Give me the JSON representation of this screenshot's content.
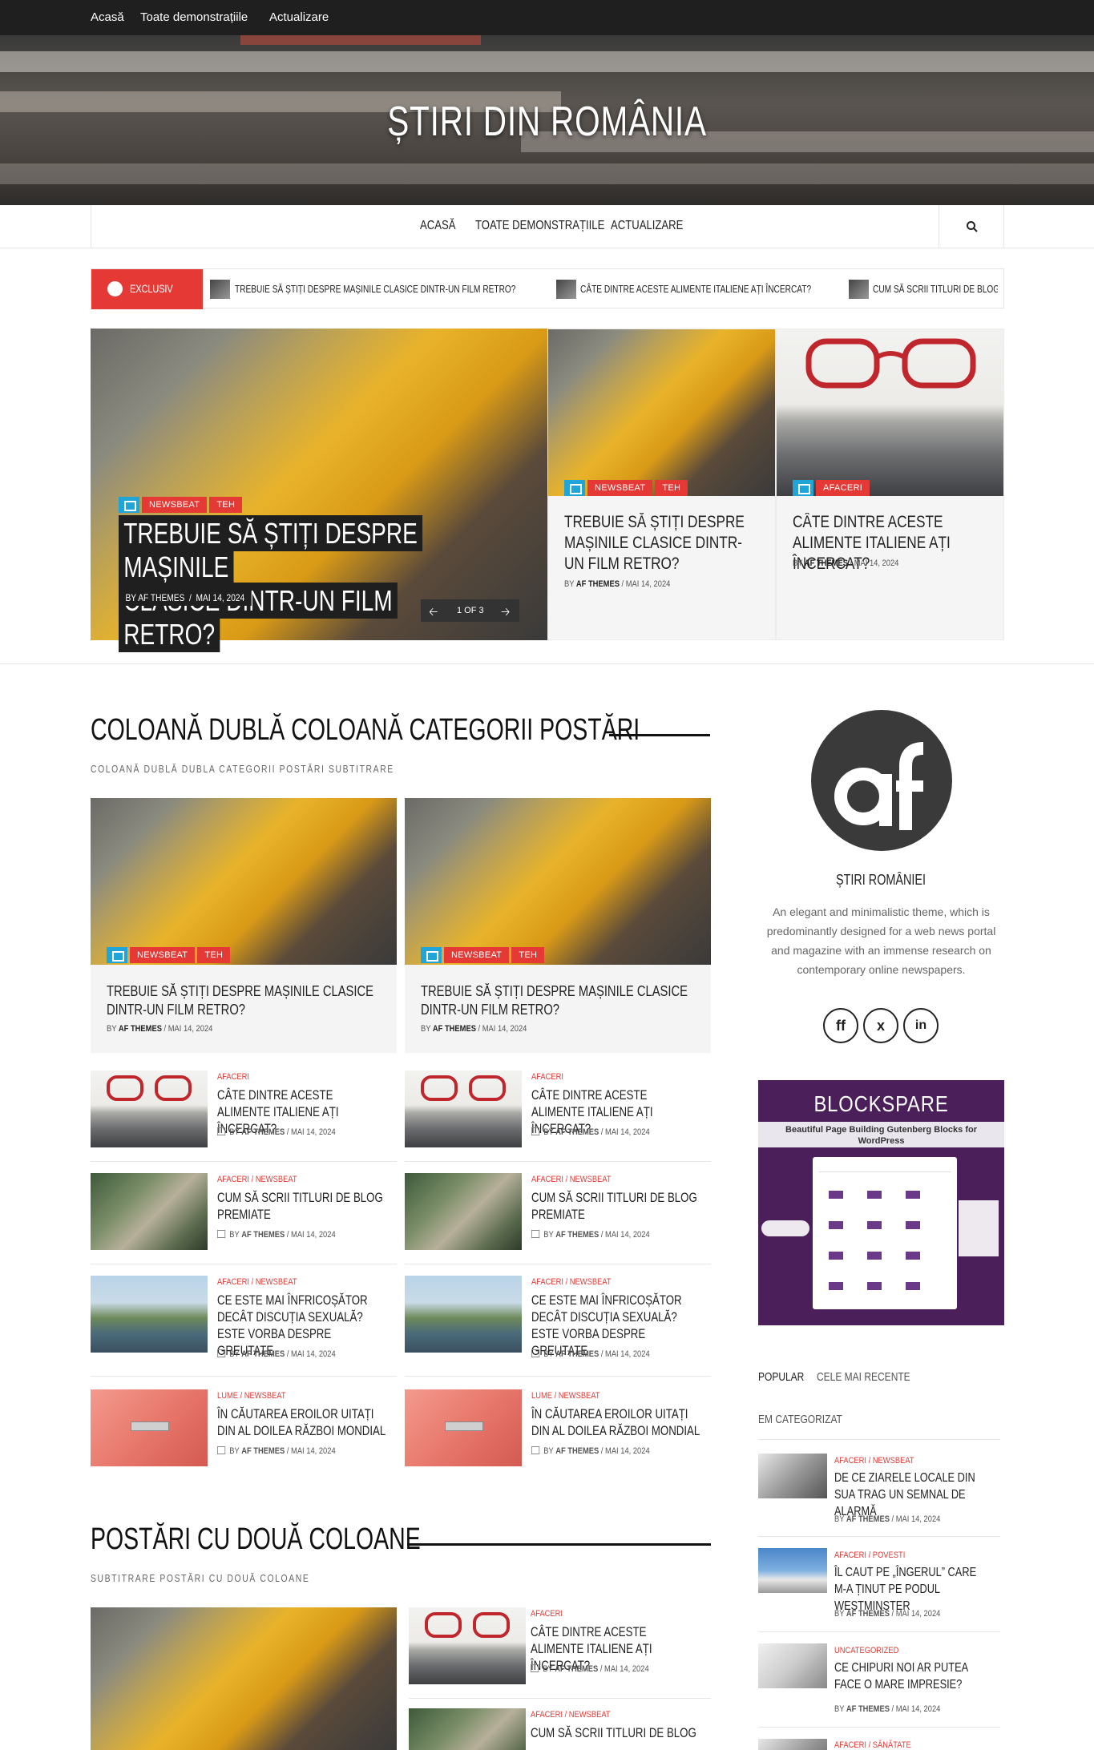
{
  "topbar": {
    "links": [
      "Acasă",
      "Toate demonstrațiile",
      "Actualizare"
    ]
  },
  "site": {
    "title": "ȘTIRI DIN ROMÂNIA"
  },
  "nav": {
    "items": [
      "ACASĂ",
      "TOATE DEMONSTRAȚIILE",
      "ACTUALIZARE"
    ],
    "search_icon": "search-icon"
  },
  "ticker": {
    "label": "EXCLUSIV",
    "items": [
      "TREBUIE SĂ ȘTIȚI DESPRE MAȘINILE CLASICE DINTR-UN FILM RETRO?",
      "CÂTE DINTRE ACESTE ALIMENTE ITALIENE AȚI ÎNCERCAT?",
      "CUM SĂ SCRII TITLURI DE BLOG"
    ]
  },
  "featured": {
    "main": {
      "tags": [
        "NEWSBEAT",
        "TEH"
      ],
      "title_line1": "TREBUIE SĂ ȘTIȚI DESPRE MAȘINILE",
      "title_line2": "CLASICE DINTR-UN FILM RETRO?",
      "author": "BY AF THEMES",
      "date": "MAI 14, 2024",
      "pager": "1 OF 3"
    },
    "cards": [
      {
        "tags": [
          "NEWSBEAT",
          "TEH"
        ],
        "title": "TREBUIE SĂ ȘTIȚI DESPRE MAȘINILE CLASICE DINTR-UN FILM RETRO?",
        "author": "AF THEMES",
        "date": "MAI 14, 2024"
      },
      {
        "tags": [
          "AFACERI"
        ],
        "title": "CÂTE DINTRE ACESTE ALIMENTE ITALIENE AȚI ÎNCERCAT?",
        "author": "AF THEMES",
        "date": "MAI 14, 2024"
      }
    ]
  },
  "section1": {
    "title": "COLOANĂ DUBLĂ COLOANĂ CATEGORII POSTĂRI",
    "subtitle": "COLOANĂ DUBLĂ DUBLA CATEGORII POSTĂRI SUBTITRARE",
    "big_card": {
      "tags": [
        "NEWSBEAT",
        "TEH"
      ],
      "title_line1": "TREBUIE SĂ ȘTIȚI DESPRE MAȘINILE CLASICE",
      "title_line2": "DINTR-UN FILM RETRO?",
      "author": "AF THEMES",
      "date": "MAI 14, 2024"
    },
    "list": [
      {
        "cat": "AFACERI",
        "title": "CÂTE DINTRE ACESTE ALIMENTE ITALIENE AȚI ÎNCERCAT?",
        "author": "AF THEMES",
        "date": "MAI 14, 2024"
      },
      {
        "cat": "AFACERI / NEWSBEAT",
        "title": "CUM SĂ SCRII TITLURI DE BLOG PREMIATE",
        "author": "AF THEMES",
        "date": "MAI 14, 2024"
      },
      {
        "cat": "AFACERI / NEWSBEAT",
        "title": "CE ESTE MAI ÎNFRICOȘĂTOR DECÂT DISCUȚIA SEXUALĂ? ESTE VORBA DESPRE GREUTATE",
        "author": "AF THEMES",
        "date": "MAI 14, 2024"
      },
      {
        "cat": "LUME / NEWSBEAT",
        "title": "ÎN CĂUTAREA EROILOR UITAȚI DIN AL DOILEA RĂZBOI MONDIAL",
        "author": "AF THEMES",
        "date": "MAI 14, 2024"
      }
    ]
  },
  "section2": {
    "title": "POSTĂRI CU DOUĂ COLOANE",
    "subtitle": "SUBTITRARE POSTĂRI CU DOUĂ COLOANE",
    "list": [
      {
        "cat": "AFACERI",
        "title": "CÂTE DINTRE ACESTE ALIMENTE ITALIENE AȚI ÎNCERCAT?",
        "author": "AF THEMES",
        "date": "MAI 14, 2024"
      },
      {
        "cat": "AFACERI / NEWSBEAT",
        "title": "CUM SĂ SCRII TITLURI DE BLOG"
      }
    ]
  },
  "sidebar": {
    "profile_name": "ȘTIRI ROMÂNIEI",
    "profile_desc": "An elegant and minimalistic theme, which is predominantly designed for a web news portal and magazine with an immense research on contemporary online newspapers.",
    "social": [
      "ff",
      "x",
      "in"
    ],
    "ad": {
      "title": "BLOCKSPARE",
      "subtitle": "Beautiful Page Building Gutenberg Blocks for WordPress"
    },
    "tabs": [
      "POPULAR",
      "CELE MAI RECENTE",
      "EM CATEGORIZAT"
    ],
    "posts": [
      {
        "cat": "AFACERI / NEWSBEAT",
        "title": "DE CE ZIARELE LOCALE DIN SUA TRAG UN SEMNAL DE ALARMĂ",
        "author": "AF THEMES",
        "date": "MAI 14, 2024"
      },
      {
        "cat": "AFACERI / POVESTI",
        "title": "ÎL CAUT PE „ÎNGERUL” CARE M-A ȚINUT PE PODUL WESTMINSTER",
        "author": "AF THEMES",
        "date": "MAI 14, 2024"
      },
      {
        "cat": "UNCATEGORIZED",
        "title": "CE CHIPURI NOI AR PUTEA FACE O MARE IMPRESIE?",
        "author": "AF THEMES",
        "date": "MAI 14, 2024"
      },
      {
        "cat": "AFACERI / SĂNĂTATE"
      }
    ]
  },
  "colors": {
    "accent": "#e53935",
    "dark": "#1f1f1f",
    "icon_blue": "#1fa5d8",
    "ad_purple": "#4a1f5a"
  }
}
